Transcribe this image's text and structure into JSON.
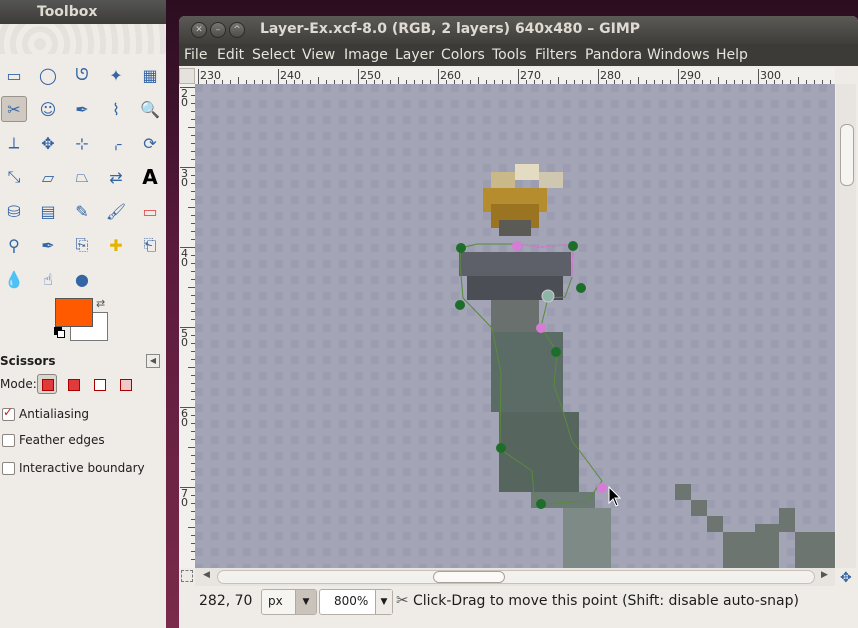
{
  "toolbox": {
    "title": "Toolbox",
    "tools": [
      "rect-select-icon",
      "ellipse-select-icon",
      "free-select-icon",
      "fuzzy-select-icon",
      "select-by-color-icon",
      "scissors-icon",
      "foreground-select-icon",
      "paths-icon",
      "color-picker-icon",
      "zoom-icon",
      "measure-icon",
      "move-icon",
      "align-icon",
      "crop-icon",
      "rotate-icon",
      "scale-icon",
      "shear-icon",
      "perspective-icon",
      "flip-icon",
      "text-icon",
      "bucket-fill-icon",
      "blend-icon",
      "pencil-icon",
      "paintbrush-icon",
      "eraser-icon",
      "airbrush-icon",
      "ink-icon",
      "clone-icon",
      "heal-icon",
      "perspective-clone-icon",
      "blur-sharpen-icon",
      "smudge-icon",
      "dodge-burn-icon"
    ],
    "fg_color": "#ff5a00",
    "bg_color": "#ffffff",
    "options_title": "Scissors",
    "mode_label": "Mode:",
    "options": [
      {
        "label": "Antialiasing",
        "checked": true
      },
      {
        "label": "Feather edges",
        "checked": false
      },
      {
        "label": "Interactive boundary",
        "checked": false
      }
    ]
  },
  "image_window": {
    "title": "Layer-Ex.xcf-8.0 (RGB, 2 layers) 640x480 – GIMP",
    "menus": [
      "File",
      "Edit",
      "Select",
      "View",
      "Image",
      "Layer",
      "Colors",
      "Tools",
      "Filters",
      "Pandora",
      "Windows",
      "Help"
    ],
    "ruler_h_labels": [
      "230",
      "240",
      "250",
      "260",
      "270",
      "280",
      "290",
      "300"
    ],
    "ruler_v_labels": [
      "20",
      "30",
      "40",
      "50",
      "60",
      "70"
    ],
    "status": {
      "coords": "282, 70",
      "unit": "px",
      "zoom": "800%",
      "message": "Click-Drag to move this point (Shift: disable auto-snap)"
    }
  }
}
